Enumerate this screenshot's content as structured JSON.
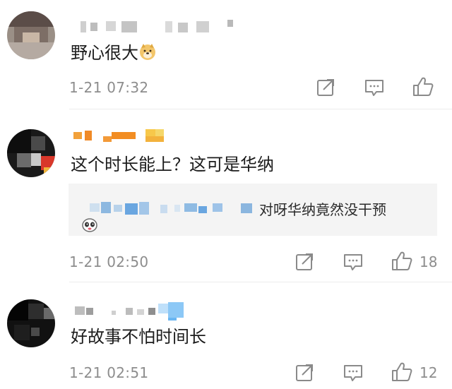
{
  "comments": [
    {
      "text": "野心很大",
      "time": "1-21 07:32",
      "likes": ""
    },
    {
      "text": "这个时长能上？这可是华纳",
      "time": "1-21 02:50",
      "likes": "18",
      "reply": {
        "text": "对呀华纳竟然没干预"
      }
    },
    {
      "text": "好故事不怕时间长",
      "time": "1-21 02:51",
      "likes": "12"
    }
  ],
  "icons": {
    "share": "share-icon",
    "comment": "comment-icon",
    "like": "thumbs-up-icon",
    "doge": "doge-emoji-icon",
    "reply_emoji": "panda-emoji-icon"
  },
  "colors": {
    "accent_orange": "#f29a2e",
    "highlight_yellow": "#f6d36a",
    "blur_blue": "#6aa6e0",
    "meta_gray": "#8d8d8d"
  }
}
